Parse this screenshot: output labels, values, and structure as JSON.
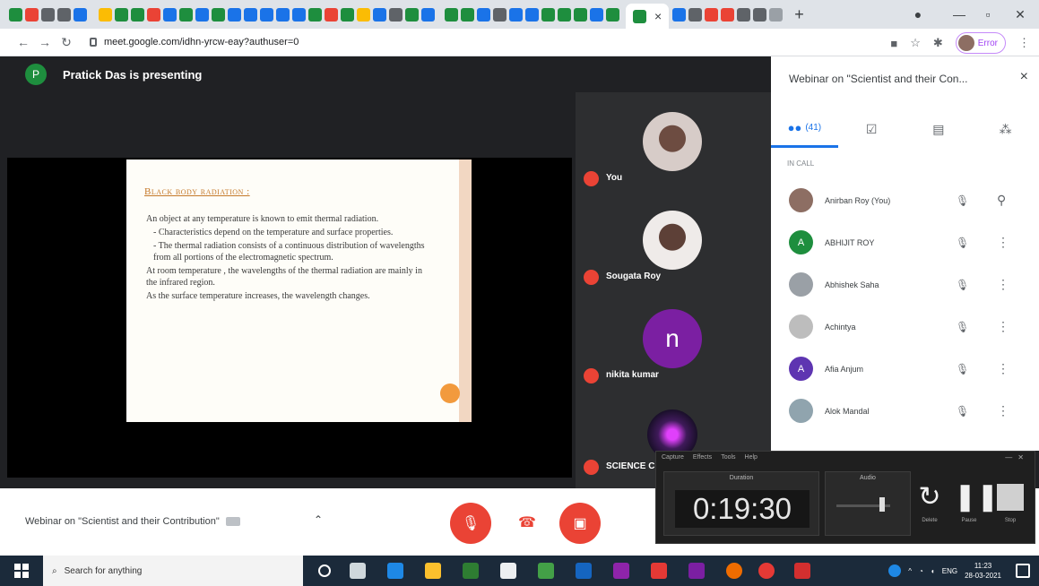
{
  "browser": {
    "active_tab_close": "×",
    "new_tab": "+",
    "url": "meet.google.com/idhn-yrcw-eay?authuser=0",
    "profile_label": "Error"
  },
  "meet": {
    "presenter_initial": "P",
    "presenter_text": "Pratick Das is presenting",
    "slide": {
      "title": "Black body radiation :",
      "lines": [
        "An object at any temperature is known to emit thermal radiation.",
        "- Characteristics depend on the temperature and surface properties.",
        "- The thermal radiation consists of a continuous distribution of wavelengths from all portions of the electromagnetic spectrum.",
        "At room temperature , the wavelengths of the thermal radiation are mainly in the infrared region.",
        "As the surface temperature increases, the wavelength changes."
      ]
    },
    "tiles": [
      {
        "name": "You"
      },
      {
        "name": "Sougata Roy"
      },
      {
        "name": "nikita kumar",
        "initial": "n"
      },
      {
        "name": "SCIENCE C"
      }
    ],
    "meeting_title": "Webinar on \"Scientist and their Contribution\""
  },
  "panel": {
    "title": "Webinar on \"Scientist and their Con...",
    "close": "×",
    "people_count": "(41)",
    "section_label": "IN CALL",
    "people": [
      {
        "name": "Anirban Roy (You)",
        "initial": "",
        "color": "#8d6e63"
      },
      {
        "name": "ABHIJIT ROY",
        "initial": "A",
        "color": "#1e8e3e"
      },
      {
        "name": "Abhishek Saha",
        "initial": "",
        "color": "#9aa0a6"
      },
      {
        "name": "Achintya",
        "initial": "",
        "color": "#bdbdbd"
      },
      {
        "name": "Afia Anjum",
        "initial": "A",
        "color": "#5e35b1"
      },
      {
        "name": "Alok Mandal",
        "initial": "",
        "color": "#90a4ae"
      }
    ]
  },
  "recorder": {
    "menu": [
      "Capture",
      "Effects",
      "Tools",
      "Help"
    ],
    "duration_label": "Duration",
    "time": "0:19:30",
    "audio_label": "Audio",
    "audio_level": 0.85,
    "delete_label": "Delete",
    "pause_label": "Pause",
    "stop_label": "Stop"
  },
  "taskbar": {
    "search_placeholder": "Search for anything",
    "lang": "ENG",
    "time": "11:23",
    "date": "28-03-2021"
  }
}
